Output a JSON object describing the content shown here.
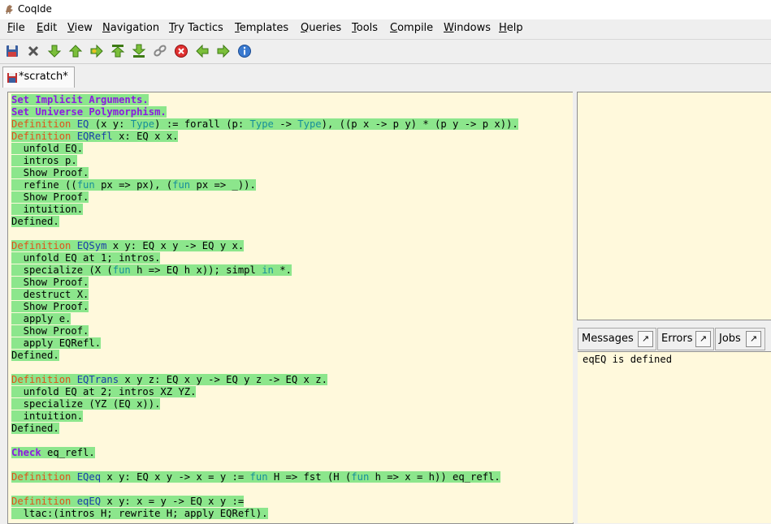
{
  "window": {
    "title": "CoqIde"
  },
  "menu": [
    "File",
    "Edit",
    "View",
    "Navigation",
    "Try Tactics",
    "Templates",
    "Queries",
    "Tools",
    "Compile",
    "Windows",
    "Help"
  ],
  "toolbar": {
    "icons": [
      "save-icon",
      "close-icon",
      "forward-one-icon",
      "backward-one-icon",
      "go-to-cursor-icon",
      "restart-icon",
      "go-to-end-icon",
      "broken-chain-icon",
      "interrupt-icon",
      "previous-occurrence-icon",
      "next-occurrence-icon",
      "about-icon"
    ]
  },
  "tabs": [
    {
      "label": "*scratch*"
    }
  ],
  "editor": {
    "lines": [
      [
        [
          "kp",
          "Set Implicit Arguments."
        ]
      ],
      [
        [
          "kp",
          "Set Universe Polymorphism."
        ]
      ],
      [
        [
          "kw",
          "Definition "
        ],
        [
          "id",
          "EQ"
        ],
        [
          "t",
          " (x y: "
        ],
        [
          "ty",
          "Type"
        ],
        [
          "t",
          ") := forall (p: "
        ],
        [
          "ty",
          "Type"
        ],
        [
          "t",
          " -> "
        ],
        [
          "ty",
          "Type"
        ],
        [
          "t",
          "), ((p x -> p y) * (p y -> p x))."
        ]
      ],
      [
        [
          "kw",
          "Definition "
        ],
        [
          "id",
          "EQRefl"
        ],
        [
          "t",
          " x: EQ x x."
        ]
      ],
      [
        [
          "t",
          "  unfold EQ."
        ]
      ],
      [
        [
          "t",
          "  intros p."
        ]
      ],
      [
        [
          "t",
          "  Show Proof."
        ]
      ],
      [
        [
          "t",
          "  refine (("
        ],
        [
          "fn",
          "fun"
        ],
        [
          "t",
          " px => px), ("
        ],
        [
          "fn",
          "fun"
        ],
        [
          "t",
          " px => _))."
        ]
      ],
      [
        [
          "t",
          "  Show Proof."
        ]
      ],
      [
        [
          "t",
          "  intuition."
        ]
      ],
      [
        [
          "t",
          "Defined."
        ]
      ],
      [],
      [
        [
          "kw",
          "Definition "
        ],
        [
          "id",
          "EQSym"
        ],
        [
          "t",
          " x y: EQ x y -> EQ y x."
        ]
      ],
      [
        [
          "t",
          "  unfold EQ at 1; intros."
        ]
      ],
      [
        [
          "t",
          "  specialize (X ("
        ],
        [
          "fn",
          "fun"
        ],
        [
          "t",
          " h => EQ h x)); simpl "
        ],
        [
          "fn",
          "in"
        ],
        [
          "t",
          " *."
        ]
      ],
      [
        [
          "t",
          "  Show Proof."
        ]
      ],
      [
        [
          "t",
          "  destruct X."
        ]
      ],
      [
        [
          "t",
          "  Show Proof."
        ]
      ],
      [
        [
          "t",
          "  apply e."
        ]
      ],
      [
        [
          "t",
          "  Show Proof."
        ]
      ],
      [
        [
          "t",
          "  apply EQRefl."
        ]
      ],
      [
        [
          "t",
          "Defined."
        ]
      ],
      [],
      [
        [
          "kw",
          "Definition "
        ],
        [
          "id",
          "EQTrans"
        ],
        [
          "t",
          " x y z: EQ x y -> EQ y z -> EQ x z."
        ]
      ],
      [
        [
          "t",
          "  unfold EQ at 2; intros XZ YZ."
        ]
      ],
      [
        [
          "t",
          "  specialize (YZ (EQ x))."
        ]
      ],
      [
        [
          "t",
          "  intuition."
        ]
      ],
      [
        [
          "t",
          "Defined."
        ]
      ],
      [],
      [
        [
          "ck",
          "Check"
        ],
        [
          "t",
          " eq_refl."
        ]
      ],
      [],
      [
        [
          "kw",
          "Definition "
        ],
        [
          "id",
          "EQeq"
        ],
        [
          "t",
          " x y: EQ x y -> x = y := "
        ],
        [
          "fn",
          "fun"
        ],
        [
          "t",
          " H => fst (H ("
        ],
        [
          "fn",
          "fun"
        ],
        [
          "t",
          " h => x = h)) eq_refl."
        ]
      ],
      [],
      [
        [
          "kw",
          "Definition "
        ],
        [
          "id",
          "eqEQ"
        ],
        [
          "t",
          " x y: x = y -> EQ x y :="
        ]
      ],
      [
        [
          "t",
          "  ltac:(intros H; rewrite H; apply EQRefl)."
        ]
      ]
    ]
  },
  "message_tabs": [
    {
      "label": "Messages",
      "detach": "↗"
    },
    {
      "label": "Errors",
      "detach": "↗"
    },
    {
      "label": "Jobs",
      "detach": "↗"
    }
  ],
  "messages": {
    "text": "eqEQ is defined"
  },
  "colors": {
    "processed": "#8ce68c",
    "background": "#fff9dc",
    "keyword": "#e0531a",
    "vernac": "#8c1ae0",
    "identifier": "#1a3fa8",
    "type": "#178f9a"
  }
}
